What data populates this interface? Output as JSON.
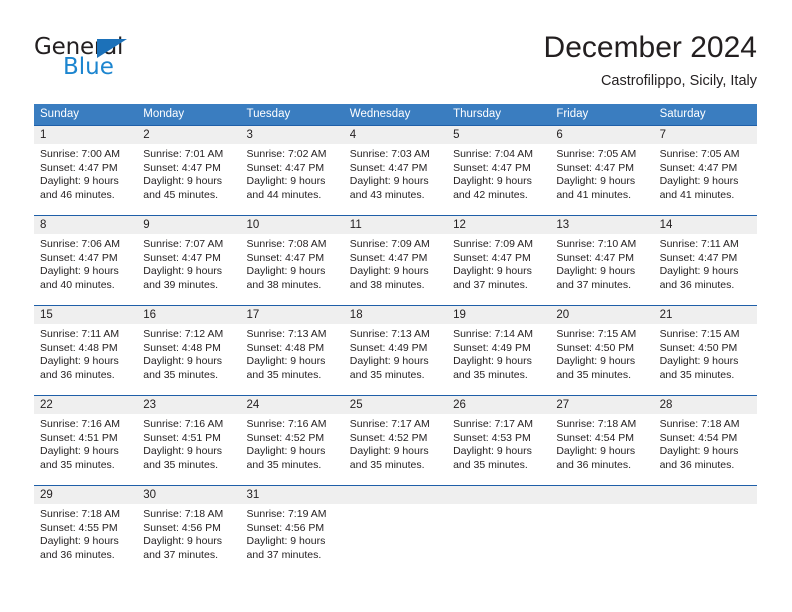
{
  "brand": {
    "name_top": "General",
    "name_bottom": "Blue",
    "triangle_color": "#1c71b9",
    "blue_text_color": "#1c85cf"
  },
  "header": {
    "title": "December 2024",
    "subtitle": "Castrofilippo, Sicily, Italy"
  },
  "theme": {
    "header_row_bg": "#3a7dc0",
    "week_separator": "#1f5fa8",
    "daynum_band_bg": "#efefef",
    "text_color": "#231f20"
  },
  "weekdays": [
    "Sunday",
    "Monday",
    "Tuesday",
    "Wednesday",
    "Thursday",
    "Friday",
    "Saturday"
  ],
  "weeks": [
    {
      "days": [
        {
          "num": "1",
          "sunrise": "Sunrise: 7:00 AM",
          "sunset": "Sunset: 4:47 PM",
          "daylight1": "Daylight: 9 hours",
          "daylight2": "and 46 minutes."
        },
        {
          "num": "2",
          "sunrise": "Sunrise: 7:01 AM",
          "sunset": "Sunset: 4:47 PM",
          "daylight1": "Daylight: 9 hours",
          "daylight2": "and 45 minutes."
        },
        {
          "num": "3",
          "sunrise": "Sunrise: 7:02 AM",
          "sunset": "Sunset: 4:47 PM",
          "daylight1": "Daylight: 9 hours",
          "daylight2": "and 44 minutes."
        },
        {
          "num": "4",
          "sunrise": "Sunrise: 7:03 AM",
          "sunset": "Sunset: 4:47 PM",
          "daylight1": "Daylight: 9 hours",
          "daylight2": "and 43 minutes."
        },
        {
          "num": "5",
          "sunrise": "Sunrise: 7:04 AM",
          "sunset": "Sunset: 4:47 PM",
          "daylight1": "Daylight: 9 hours",
          "daylight2": "and 42 minutes."
        },
        {
          "num": "6",
          "sunrise": "Sunrise: 7:05 AM",
          "sunset": "Sunset: 4:47 PM",
          "daylight1": "Daylight: 9 hours",
          "daylight2": "and 41 minutes."
        },
        {
          "num": "7",
          "sunrise": "Sunrise: 7:05 AM",
          "sunset": "Sunset: 4:47 PM",
          "daylight1": "Daylight: 9 hours",
          "daylight2": "and 41 minutes."
        }
      ]
    },
    {
      "days": [
        {
          "num": "8",
          "sunrise": "Sunrise: 7:06 AM",
          "sunset": "Sunset: 4:47 PM",
          "daylight1": "Daylight: 9 hours",
          "daylight2": "and 40 minutes."
        },
        {
          "num": "9",
          "sunrise": "Sunrise: 7:07 AM",
          "sunset": "Sunset: 4:47 PM",
          "daylight1": "Daylight: 9 hours",
          "daylight2": "and 39 minutes."
        },
        {
          "num": "10",
          "sunrise": "Sunrise: 7:08 AM",
          "sunset": "Sunset: 4:47 PM",
          "daylight1": "Daylight: 9 hours",
          "daylight2": "and 38 minutes."
        },
        {
          "num": "11",
          "sunrise": "Sunrise: 7:09 AM",
          "sunset": "Sunset: 4:47 PM",
          "daylight1": "Daylight: 9 hours",
          "daylight2": "and 38 minutes."
        },
        {
          "num": "12",
          "sunrise": "Sunrise: 7:09 AM",
          "sunset": "Sunset: 4:47 PM",
          "daylight1": "Daylight: 9 hours",
          "daylight2": "and 37 minutes."
        },
        {
          "num": "13",
          "sunrise": "Sunrise: 7:10 AM",
          "sunset": "Sunset: 4:47 PM",
          "daylight1": "Daylight: 9 hours",
          "daylight2": "and 37 minutes."
        },
        {
          "num": "14",
          "sunrise": "Sunrise: 7:11 AM",
          "sunset": "Sunset: 4:47 PM",
          "daylight1": "Daylight: 9 hours",
          "daylight2": "and 36 minutes."
        }
      ]
    },
    {
      "days": [
        {
          "num": "15",
          "sunrise": "Sunrise: 7:11 AM",
          "sunset": "Sunset: 4:48 PM",
          "daylight1": "Daylight: 9 hours",
          "daylight2": "and 36 minutes."
        },
        {
          "num": "16",
          "sunrise": "Sunrise: 7:12 AM",
          "sunset": "Sunset: 4:48 PM",
          "daylight1": "Daylight: 9 hours",
          "daylight2": "and 35 minutes."
        },
        {
          "num": "17",
          "sunrise": "Sunrise: 7:13 AM",
          "sunset": "Sunset: 4:48 PM",
          "daylight1": "Daylight: 9 hours",
          "daylight2": "and 35 minutes."
        },
        {
          "num": "18",
          "sunrise": "Sunrise: 7:13 AM",
          "sunset": "Sunset: 4:49 PM",
          "daylight1": "Daylight: 9 hours",
          "daylight2": "and 35 minutes."
        },
        {
          "num": "19",
          "sunrise": "Sunrise: 7:14 AM",
          "sunset": "Sunset: 4:49 PM",
          "daylight1": "Daylight: 9 hours",
          "daylight2": "and 35 minutes."
        },
        {
          "num": "20",
          "sunrise": "Sunrise: 7:15 AM",
          "sunset": "Sunset: 4:50 PM",
          "daylight1": "Daylight: 9 hours",
          "daylight2": "and 35 minutes."
        },
        {
          "num": "21",
          "sunrise": "Sunrise: 7:15 AM",
          "sunset": "Sunset: 4:50 PM",
          "daylight1": "Daylight: 9 hours",
          "daylight2": "and 35 minutes."
        }
      ]
    },
    {
      "days": [
        {
          "num": "22",
          "sunrise": "Sunrise: 7:16 AM",
          "sunset": "Sunset: 4:51 PM",
          "daylight1": "Daylight: 9 hours",
          "daylight2": "and 35 minutes."
        },
        {
          "num": "23",
          "sunrise": "Sunrise: 7:16 AM",
          "sunset": "Sunset: 4:51 PM",
          "daylight1": "Daylight: 9 hours",
          "daylight2": "and 35 minutes."
        },
        {
          "num": "24",
          "sunrise": "Sunrise: 7:16 AM",
          "sunset": "Sunset: 4:52 PM",
          "daylight1": "Daylight: 9 hours",
          "daylight2": "and 35 minutes."
        },
        {
          "num": "25",
          "sunrise": "Sunrise: 7:17 AM",
          "sunset": "Sunset: 4:52 PM",
          "daylight1": "Daylight: 9 hours",
          "daylight2": "and 35 minutes."
        },
        {
          "num": "26",
          "sunrise": "Sunrise: 7:17 AM",
          "sunset": "Sunset: 4:53 PM",
          "daylight1": "Daylight: 9 hours",
          "daylight2": "and 35 minutes."
        },
        {
          "num": "27",
          "sunrise": "Sunrise: 7:18 AM",
          "sunset": "Sunset: 4:54 PM",
          "daylight1": "Daylight: 9 hours",
          "daylight2": "and 36 minutes."
        },
        {
          "num": "28",
          "sunrise": "Sunrise: 7:18 AM",
          "sunset": "Sunset: 4:54 PM",
          "daylight1": "Daylight: 9 hours",
          "daylight2": "and 36 minutes."
        }
      ]
    },
    {
      "days": [
        {
          "num": "29",
          "sunrise": "Sunrise: 7:18 AM",
          "sunset": "Sunset: 4:55 PM",
          "daylight1": "Daylight: 9 hours",
          "daylight2": "and 36 minutes."
        },
        {
          "num": "30",
          "sunrise": "Sunrise: 7:18 AM",
          "sunset": "Sunset: 4:56 PM",
          "daylight1": "Daylight: 9 hours",
          "daylight2": "and 37 minutes."
        },
        {
          "num": "31",
          "sunrise": "Sunrise: 7:19 AM",
          "sunset": "Sunset: 4:56 PM",
          "daylight1": "Daylight: 9 hours",
          "daylight2": "and 37 minutes."
        },
        {
          "num": "",
          "sunrise": "",
          "sunset": "",
          "daylight1": "",
          "daylight2": ""
        },
        {
          "num": "",
          "sunrise": "",
          "sunset": "",
          "daylight1": "",
          "daylight2": ""
        },
        {
          "num": "",
          "sunrise": "",
          "sunset": "",
          "daylight1": "",
          "daylight2": ""
        },
        {
          "num": "",
          "sunrise": "",
          "sunset": "",
          "daylight1": "",
          "daylight2": ""
        }
      ]
    }
  ]
}
